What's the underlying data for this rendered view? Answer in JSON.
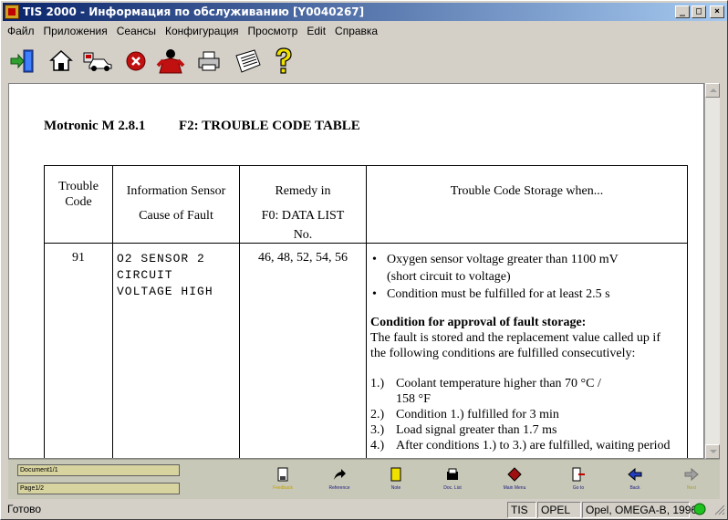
{
  "window": {
    "title": "TIS 2000 - Информация по обслуживанию [Y0040267]"
  },
  "menu": [
    "Файл",
    "Приложения",
    "Сеансы",
    "Конфигурация",
    "Просмотр",
    "Edit",
    "Справка"
  ],
  "toolbar": {
    "icons": [
      "exit-icon",
      "home-icon",
      "vehicle-icon",
      "stop-icon",
      "person-icon",
      "printer-icon",
      "newspaper-icon",
      "help-icon"
    ]
  },
  "document": {
    "system": "Motronic M 2.8.1",
    "section": "F2: TROUBLE CODE TABLE",
    "columns": {
      "c1": [
        "Trouble",
        "Code"
      ],
      "c2": [
        "Information Sensor",
        "Cause of Fault"
      ],
      "c3": [
        "Remedy in",
        "F0: DATA LIST",
        "No."
      ],
      "c4": [
        "Trouble Code Storage when..."
      ]
    },
    "row": {
      "code": "91",
      "cause": [
        "O2 SENSOR 2",
        "CIRCUIT",
        "VOLTAGE HIGH"
      ],
      "remedy": "46, 48, 52, 54, 56",
      "bullets": [
        "Oxygen sensor voltage greater than 1100 mV",
        "(short circuit to voltage)",
        "Condition must be fulfilled for at least 2.5 s"
      ],
      "approval_heading": "Condition for approval of fault storage:",
      "approval_text": [
        "The fault is stored and the replacement value called up if",
        "the following conditions are fulfilled consecutively:"
      ],
      "steps": [
        {
          "n": "1.)",
          "t": "Coolant temperature higher than 70 °C /"
        },
        {
          "n": "",
          "t": "158 °F"
        },
        {
          "n": "2.)",
          "t": "Condition 1.) fulfilled for 3 min"
        },
        {
          "n": "3.)",
          "t": "Load signal greater than 1.7 ms"
        },
        {
          "n": "4.)",
          "t": "After conditions 1.) to 3.) are fulfilled, waiting period"
        }
      ]
    }
  },
  "navigation": {
    "document_field": "Document1/1",
    "page_field": "Page1/2",
    "buttons": [
      "Feedback",
      "Reference",
      "Note",
      "Doc. List",
      "Main Menu",
      "Go to",
      "Back",
      "Next"
    ]
  },
  "status": {
    "ready": "Готово",
    "app": "TIS",
    "make": "OPEL",
    "vehicle": "Opel, OMEGA-B, 1996"
  }
}
